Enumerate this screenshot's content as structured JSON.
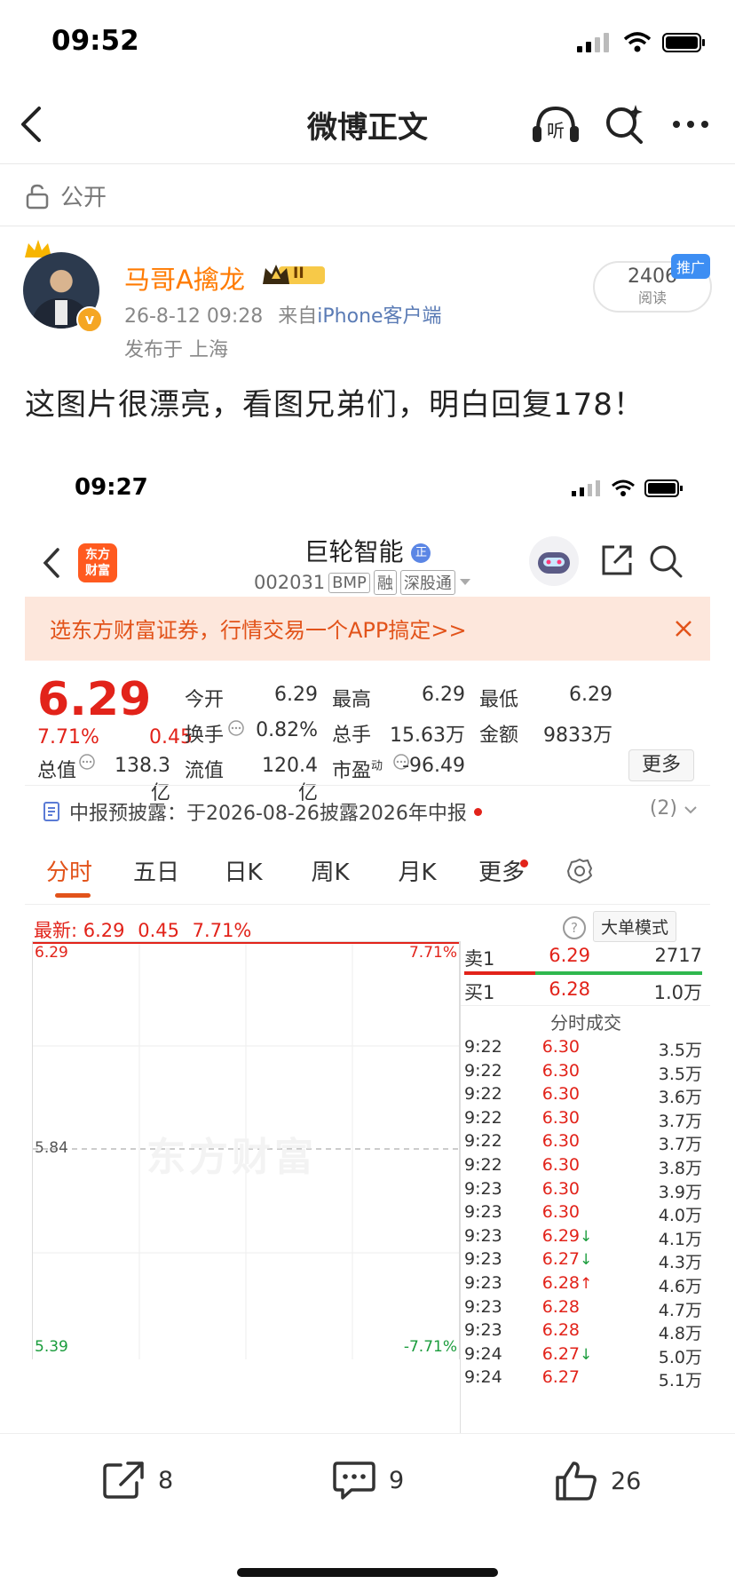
{
  "status_bar": {
    "time": "09:52"
  },
  "nav": {
    "title": "微博正文"
  },
  "visibility": {
    "label": "公开"
  },
  "author": {
    "name": "马哥A擒龙",
    "level": "II",
    "verified_icon": "v",
    "time": "26-8-12 09:28",
    "from_prefix": "来自",
    "source": "iPhone客户端",
    "location": "发布于 上海"
  },
  "reads": {
    "count": "2406",
    "label": "阅读",
    "promo_tag": "推广"
  },
  "post": {
    "text": "这图片很漂亮，看图兄弟们，明白回复178！"
  },
  "screenshot": {
    "status_time": "09:27",
    "app_logo": {
      "line1": "东方",
      "line2": "财富"
    },
    "stock_name": "巨轮智能",
    "stock_name_badge": "正",
    "stock_code": "002031",
    "code_tags": [
      "BMP",
      "融",
      "深股通"
    ],
    "banner_text": "选东方财富证券，行情交易一个APP搞定>>",
    "price": "6.29",
    "change_pct": "7.71%",
    "change_abs": "0.45",
    "quote": [
      {
        "label": "今开",
        "value": "6.29",
        "red": true
      },
      {
        "label": "最高",
        "value": "6.29",
        "red": true
      },
      {
        "label": "最低",
        "value": "6.29",
        "red": true
      },
      {
        "label": "换手",
        "value": "0.82%",
        "red": false
      },
      {
        "label": "总手",
        "value": "15.63万",
        "red": false
      },
      {
        "label": "金额",
        "value": "9833万",
        "red": false
      }
    ],
    "quote_row3": {
      "total_value_label": "总值",
      "total_value": "138.3亿",
      "float_label": "流值",
      "float_value": "120.4亿",
      "pe_label": "市盈",
      "pe_sup": "动",
      "pe_value": "-96.49"
    },
    "more_button": "更多",
    "disclosure": {
      "text": "中报预披露：于2026-08-26披露2026年中报",
      "count": "(2)"
    },
    "tabs": [
      "分时",
      "五日",
      "日K",
      "周K",
      "月K",
      "更多"
    ],
    "latest": {
      "label": "最新:",
      "price": "6.29",
      "change": "0.45",
      "pct": "7.71%"
    },
    "big_order_mode": "大单模式",
    "chart": {
      "price_top": "6.29",
      "price_mid": "5.84",
      "price_bottom": "5.39",
      "pct_top": "7.71%",
      "pct_bottom": "-7.71%",
      "watermark": "东方财富"
    },
    "order_book": [
      {
        "side": "卖1",
        "price": "6.29",
        "volume": "2717"
      },
      {
        "side": "买1",
        "price": "6.28",
        "volume": "1.0万"
      }
    ],
    "trades_title": "分时成交",
    "trades": [
      {
        "time": "9:22",
        "price": "6.30",
        "arrow": "",
        "vol": "3.5万"
      },
      {
        "time": "9:22",
        "price": "6.30",
        "arrow": "",
        "vol": "3.5万"
      },
      {
        "time": "9:22",
        "price": "6.30",
        "arrow": "",
        "vol": "3.6万"
      },
      {
        "time": "9:22",
        "price": "6.30",
        "arrow": "",
        "vol": "3.7万"
      },
      {
        "time": "9:22",
        "price": "6.30",
        "arrow": "",
        "vol": "3.7万"
      },
      {
        "time": "9:22",
        "price": "6.30",
        "arrow": "",
        "vol": "3.8万"
      },
      {
        "time": "9:23",
        "price": "6.30",
        "arrow": "",
        "vol": "3.9万"
      },
      {
        "time": "9:23",
        "price": "6.30",
        "arrow": "",
        "vol": "4.0万"
      },
      {
        "time": "9:23",
        "price": "6.29",
        "arrow": "↓",
        "vol": "4.1万"
      },
      {
        "time": "9:23",
        "price": "6.27",
        "arrow": "↓",
        "vol": "4.3万"
      },
      {
        "time": "9:23",
        "price": "6.28",
        "arrow": "↑",
        "vol": "4.6万"
      },
      {
        "time": "9:23",
        "price": "6.28",
        "arrow": "",
        "vol": "4.7万"
      },
      {
        "time": "9:23",
        "price": "6.28",
        "arrow": "",
        "vol": "4.8万"
      },
      {
        "time": "9:24",
        "price": "6.27",
        "arrow": "↓",
        "vol": "5.0万"
      },
      {
        "time": "9:24",
        "price": "6.27",
        "arrow": "",
        "vol": "5.1万"
      }
    ]
  },
  "actions": {
    "repost": "8",
    "comment": "9",
    "like": "26"
  }
}
